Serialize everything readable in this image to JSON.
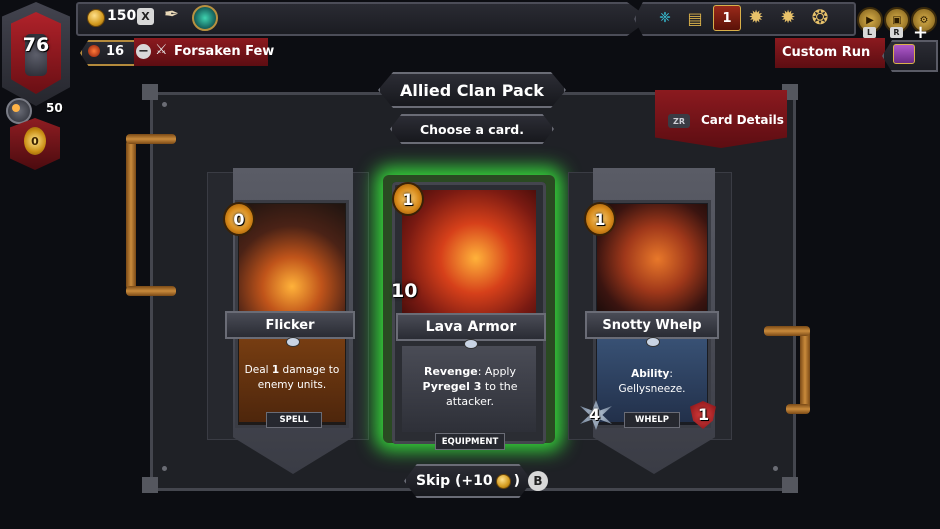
{
  "player": {
    "hp": "76",
    "gold_hud": "0",
    "ember": "50"
  },
  "topbar": {
    "gold": "150",
    "x_key": "X",
    "deck_count": "1",
    "l_key": "L",
    "r_key": "R"
  },
  "covenant": {
    "level": "16"
  },
  "mutator": {
    "label": "Forsaken Few"
  },
  "run": {
    "label": "Custom Run"
  },
  "pack": {
    "title": "Allied Clan Pack",
    "subtitle": "Choose a card.",
    "card_details_label": "Card Details",
    "card_details_key": "ZR"
  },
  "cards": [
    {
      "name": "Flicker",
      "cost": "0",
      "type": "SPELL",
      "desc_pre": "Deal ",
      "desc_bold": "1",
      "desc_post": " damage to enemy units."
    },
    {
      "name": "Lava Armor",
      "cost": "1",
      "attack": "10",
      "type": "EQUIPMENT",
      "desc_k1": "Revenge",
      "desc_mid": ": Apply ",
      "desc_k2": "Pyregel 3",
      "desc_post": " to the attacker."
    },
    {
      "name": "Snotty Whelp",
      "cost": "1",
      "type": "WHELP",
      "attack": "4",
      "health": "1",
      "desc_k1": "Ability",
      "desc_post": ": Gellysneeze."
    }
  ],
  "skip": {
    "label_pre": "Skip (+10",
    "label_post": ")",
    "key": "B"
  },
  "colors": {
    "accent_red": "#8b1a1f",
    "selection_green": "#3cff3c",
    "gold": "#d39a1e"
  }
}
